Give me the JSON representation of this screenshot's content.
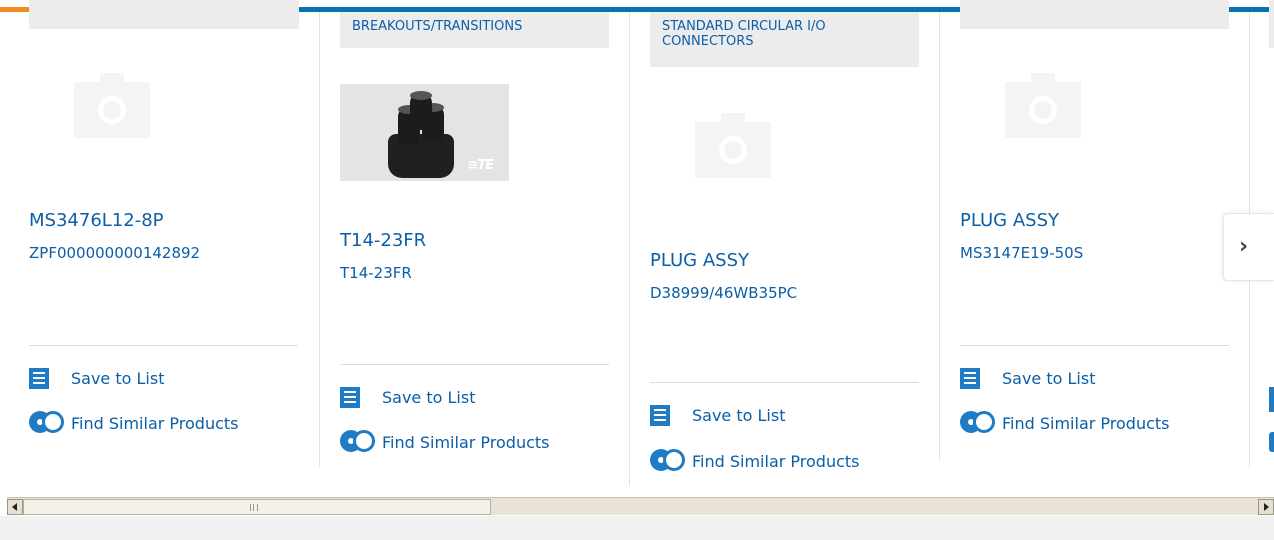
{
  "colors": {
    "link": "#0b5ea8",
    "accent": "#0b72b1",
    "topbar_highlight": "#f28c21",
    "icon": "#1f7bc4"
  },
  "cards": [
    {
      "category": "",
      "image": "camera-placeholder",
      "title": "MS3476L12-8P",
      "subtitle": "ZPF000000000142892",
      "save_label": "Save to List",
      "similar_label": "Find Similar Products"
    },
    {
      "category": "BREAKOUTS/TRANSITIONS",
      "image": "product-photo",
      "photo_logo": "≡TE",
      "title": "T14-23FR",
      "subtitle": "T14-23FR",
      "save_label": "Save to List",
      "similar_label": "Find Similar Products"
    },
    {
      "category": "STANDARD CIRCULAR I/O CONNECTORS",
      "image": "camera-placeholder",
      "title": "PLUG ASSY",
      "subtitle": "D38999/46WB35PC",
      "save_label": "Save to List",
      "similar_label": "Find Similar Products"
    },
    {
      "category": "",
      "image": "camera-placeholder",
      "title": "PLUG ASSY",
      "subtitle": "MS3147E19-50S",
      "save_label": "Save to List",
      "similar_label": "Find Similar Products"
    }
  ],
  "carousel": {
    "next_icon": "chevron-right-icon",
    "next_glyph": "›"
  },
  "scrollbar": {
    "position_fraction": 0.0,
    "visible_fraction": 0.37
  }
}
